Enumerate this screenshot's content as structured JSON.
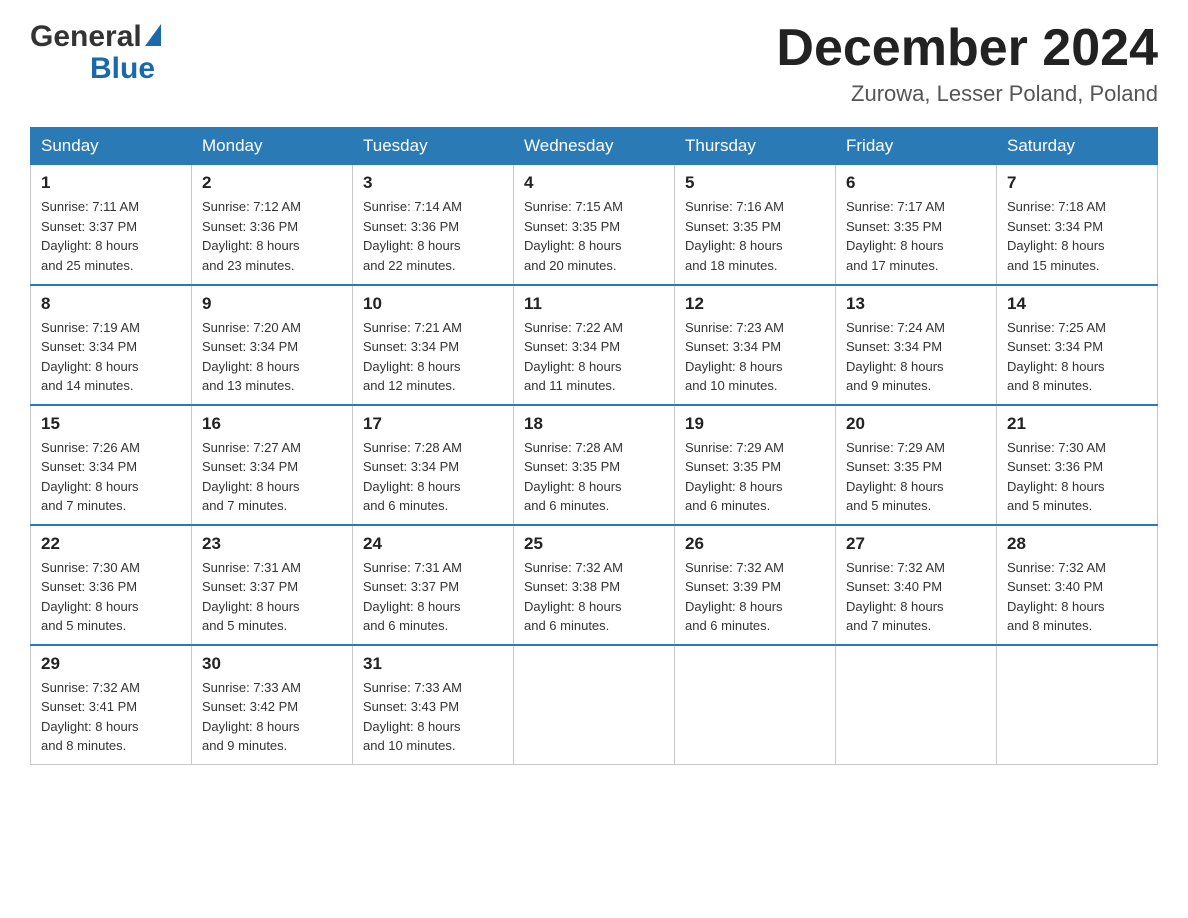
{
  "header": {
    "logo": {
      "general": "General",
      "blue": "Blue"
    },
    "title": "December 2024",
    "location": "Zurowa, Lesser Poland, Poland"
  },
  "weekdays": [
    "Sunday",
    "Monday",
    "Tuesday",
    "Wednesday",
    "Thursday",
    "Friday",
    "Saturday"
  ],
  "weeks": [
    [
      {
        "day": "1",
        "sunrise": "7:11 AM",
        "sunset": "3:37 PM",
        "daylight": "8 hours and 25 minutes."
      },
      {
        "day": "2",
        "sunrise": "7:12 AM",
        "sunset": "3:36 PM",
        "daylight": "8 hours and 23 minutes."
      },
      {
        "day": "3",
        "sunrise": "7:14 AM",
        "sunset": "3:36 PM",
        "daylight": "8 hours and 22 minutes."
      },
      {
        "day": "4",
        "sunrise": "7:15 AM",
        "sunset": "3:35 PM",
        "daylight": "8 hours and 20 minutes."
      },
      {
        "day": "5",
        "sunrise": "7:16 AM",
        "sunset": "3:35 PM",
        "daylight": "8 hours and 18 minutes."
      },
      {
        "day": "6",
        "sunrise": "7:17 AM",
        "sunset": "3:35 PM",
        "daylight": "8 hours and 17 minutes."
      },
      {
        "day": "7",
        "sunrise": "7:18 AM",
        "sunset": "3:34 PM",
        "daylight": "8 hours and 15 minutes."
      }
    ],
    [
      {
        "day": "8",
        "sunrise": "7:19 AM",
        "sunset": "3:34 PM",
        "daylight": "8 hours and 14 minutes."
      },
      {
        "day": "9",
        "sunrise": "7:20 AM",
        "sunset": "3:34 PM",
        "daylight": "8 hours and 13 minutes."
      },
      {
        "day": "10",
        "sunrise": "7:21 AM",
        "sunset": "3:34 PM",
        "daylight": "8 hours and 12 minutes."
      },
      {
        "day": "11",
        "sunrise": "7:22 AM",
        "sunset": "3:34 PM",
        "daylight": "8 hours and 11 minutes."
      },
      {
        "day": "12",
        "sunrise": "7:23 AM",
        "sunset": "3:34 PM",
        "daylight": "8 hours and 10 minutes."
      },
      {
        "day": "13",
        "sunrise": "7:24 AM",
        "sunset": "3:34 PM",
        "daylight": "8 hours and 9 minutes."
      },
      {
        "day": "14",
        "sunrise": "7:25 AM",
        "sunset": "3:34 PM",
        "daylight": "8 hours and 8 minutes."
      }
    ],
    [
      {
        "day": "15",
        "sunrise": "7:26 AM",
        "sunset": "3:34 PM",
        "daylight": "8 hours and 7 minutes."
      },
      {
        "day": "16",
        "sunrise": "7:27 AM",
        "sunset": "3:34 PM",
        "daylight": "8 hours and 7 minutes."
      },
      {
        "day": "17",
        "sunrise": "7:28 AM",
        "sunset": "3:34 PM",
        "daylight": "8 hours and 6 minutes."
      },
      {
        "day": "18",
        "sunrise": "7:28 AM",
        "sunset": "3:35 PM",
        "daylight": "8 hours and 6 minutes."
      },
      {
        "day": "19",
        "sunrise": "7:29 AM",
        "sunset": "3:35 PM",
        "daylight": "8 hours and 6 minutes."
      },
      {
        "day": "20",
        "sunrise": "7:29 AM",
        "sunset": "3:35 PM",
        "daylight": "8 hours and 5 minutes."
      },
      {
        "day": "21",
        "sunrise": "7:30 AM",
        "sunset": "3:36 PM",
        "daylight": "8 hours and 5 minutes."
      }
    ],
    [
      {
        "day": "22",
        "sunrise": "7:30 AM",
        "sunset": "3:36 PM",
        "daylight": "8 hours and 5 minutes."
      },
      {
        "day": "23",
        "sunrise": "7:31 AM",
        "sunset": "3:37 PM",
        "daylight": "8 hours and 5 minutes."
      },
      {
        "day": "24",
        "sunrise": "7:31 AM",
        "sunset": "3:37 PM",
        "daylight": "8 hours and 6 minutes."
      },
      {
        "day": "25",
        "sunrise": "7:32 AM",
        "sunset": "3:38 PM",
        "daylight": "8 hours and 6 minutes."
      },
      {
        "day": "26",
        "sunrise": "7:32 AM",
        "sunset": "3:39 PM",
        "daylight": "8 hours and 6 minutes."
      },
      {
        "day": "27",
        "sunrise": "7:32 AM",
        "sunset": "3:40 PM",
        "daylight": "8 hours and 7 minutes."
      },
      {
        "day": "28",
        "sunrise": "7:32 AM",
        "sunset": "3:40 PM",
        "daylight": "8 hours and 8 minutes."
      }
    ],
    [
      {
        "day": "29",
        "sunrise": "7:32 AM",
        "sunset": "3:41 PM",
        "daylight": "8 hours and 8 minutes."
      },
      {
        "day": "30",
        "sunrise": "7:33 AM",
        "sunset": "3:42 PM",
        "daylight": "8 hours and 9 minutes."
      },
      {
        "day": "31",
        "sunrise": "7:33 AM",
        "sunset": "3:43 PM",
        "daylight": "8 hours and 10 minutes."
      },
      null,
      null,
      null,
      null
    ]
  ],
  "labels": {
    "sunrise": "Sunrise:",
    "sunset": "Sunset:",
    "daylight": "Daylight:"
  }
}
